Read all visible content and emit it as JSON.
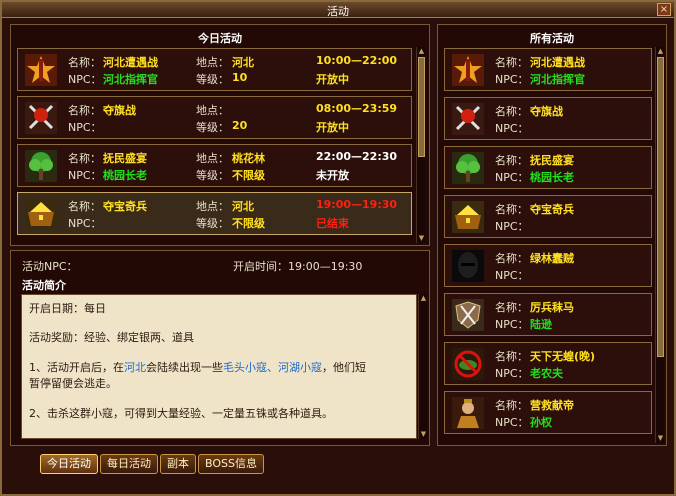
{
  "window": {
    "title": "活动",
    "close": "×"
  },
  "today": {
    "title": "今日活动",
    "labels": {
      "name": "名称：",
      "npc": "NPC：",
      "place": "地点：",
      "level": "等级："
    },
    "items": [
      {
        "icon": "battle-banner-icon",
        "name": "河北遭遇战",
        "npc": "河北指挥官",
        "place": "河北",
        "level": "10",
        "time": "10:00—22:00",
        "status": "开放中"
      },
      {
        "icon": "crossed-swords-icon",
        "name": "夺旗战",
        "npc": "",
        "place": "",
        "level": "20",
        "time": "08:00—23:59",
        "status": "开放中"
      },
      {
        "icon": "tree-icon",
        "name": "抚民盛宴",
        "npc": "桃园长老",
        "place": "桃花林",
        "level": "不限级",
        "time": "22:00—22:30",
        "status": "未开放"
      },
      {
        "icon": "treasure-chest-icon",
        "name": "夺宝奇兵",
        "npc": "",
        "place": "河北",
        "level": "不限级",
        "time": "19:00—19:30",
        "status": "已结束"
      }
    ]
  },
  "detail": {
    "npc_label": "活动NPC：",
    "open_time_label": "开启时间：19:00—19:30",
    "intro_title": "活动简介",
    "lines": {
      "l1": "开启日期：每日",
      "l2": "活动奖励：经验、绑定银两、道具",
      "l3a": "1、活动开启后，在",
      "l3b": "河北",
      "l3c": "会陆续出现一些",
      "l3d": "毛头小寇、河湖小寇",
      "l3e": "，他们短",
      "l4": "暂停留便会逃走。",
      "l5": "2、击杀这群小寇，可得到大量经验、一定量五铢或各种道具。"
    }
  },
  "all": {
    "title": "所有活动",
    "items": [
      {
        "icon": "battle-banner-icon",
        "name": "河北遭遇战",
        "npc": "河北指挥官"
      },
      {
        "icon": "crossed-swords-icon",
        "name": "夺旗战",
        "npc": ""
      },
      {
        "icon": "tree-icon",
        "name": "抚民盛宴",
        "npc": "桃园长老"
      },
      {
        "icon": "treasure-chest-icon",
        "name": "夺宝奇兵",
        "npc": ""
      },
      {
        "icon": "masked-bandit-icon",
        "name": "绿林蠢贼",
        "npc": ""
      },
      {
        "icon": "shield-swords-icon",
        "name": "厉兵秣马",
        "npc": "陆逊"
      },
      {
        "icon": "locust-ban-icon",
        "name": "天下无蝗(晚)",
        "npc": "老农夫"
      },
      {
        "icon": "warrior-portrait-icon",
        "name": "营救献帝",
        "npc": "孙权"
      }
    ]
  },
  "tabs": [
    "今日活动",
    "每日活动",
    "副本",
    "BOSS信息"
  ]
}
